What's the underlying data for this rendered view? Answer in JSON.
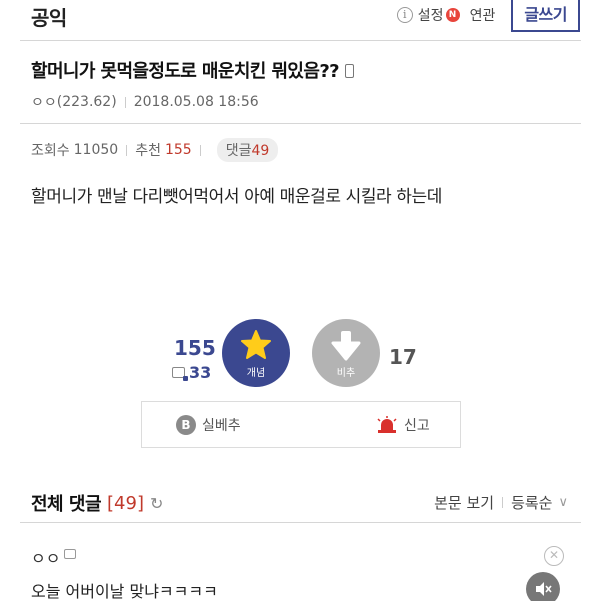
{
  "header": {
    "board_name": "공익",
    "info_glyph": "i",
    "setting_label": "설정",
    "new_badge": "N",
    "related_label": "연관",
    "write_button": "글쓰기"
  },
  "post": {
    "title": "할머니가 못먹을정도로 매운치킨 뭐있음??",
    "author": "ㅇㅇ",
    "author_ip": "(223.62)",
    "datetime": "2018.05.08 18:56",
    "views_label": "조회수",
    "views_value": "11050",
    "recommend_label": "추천",
    "recommend_value": "155",
    "comments_label": "댓글",
    "comments_value": "49",
    "body": "할머니가 맨날 다리뺏어먹어서 아예 매운걸로 시킬라 하는데"
  },
  "votes": {
    "up_count": "155",
    "fixed_count": "33",
    "up_label": "개념",
    "down_label": "비추",
    "down_count": "17",
    "up_color": "#3b4890",
    "down_color": "#b3b3b3"
  },
  "actions": {
    "b_glyph": "B",
    "real_downvote": "실베추",
    "report": "신고"
  },
  "comments": {
    "title": "전체 댓글",
    "count": "[49]",
    "view_body": "본문 보기",
    "sort": "등록순",
    "first": {
      "author": "ㅇㅇ",
      "text": "오늘 어버이날 맞냐ㅋㅋㅋㅋ"
    }
  },
  "icons": {
    "info": "info-icon",
    "mobile": "mobile-icon",
    "star": "star-icon",
    "arrow_down": "arrow-down-icon",
    "siren": "siren-icon",
    "refresh": "refresh-icon",
    "chevron": "chevron-down-icon",
    "close": "close-icon",
    "mute": "mute-icon"
  }
}
